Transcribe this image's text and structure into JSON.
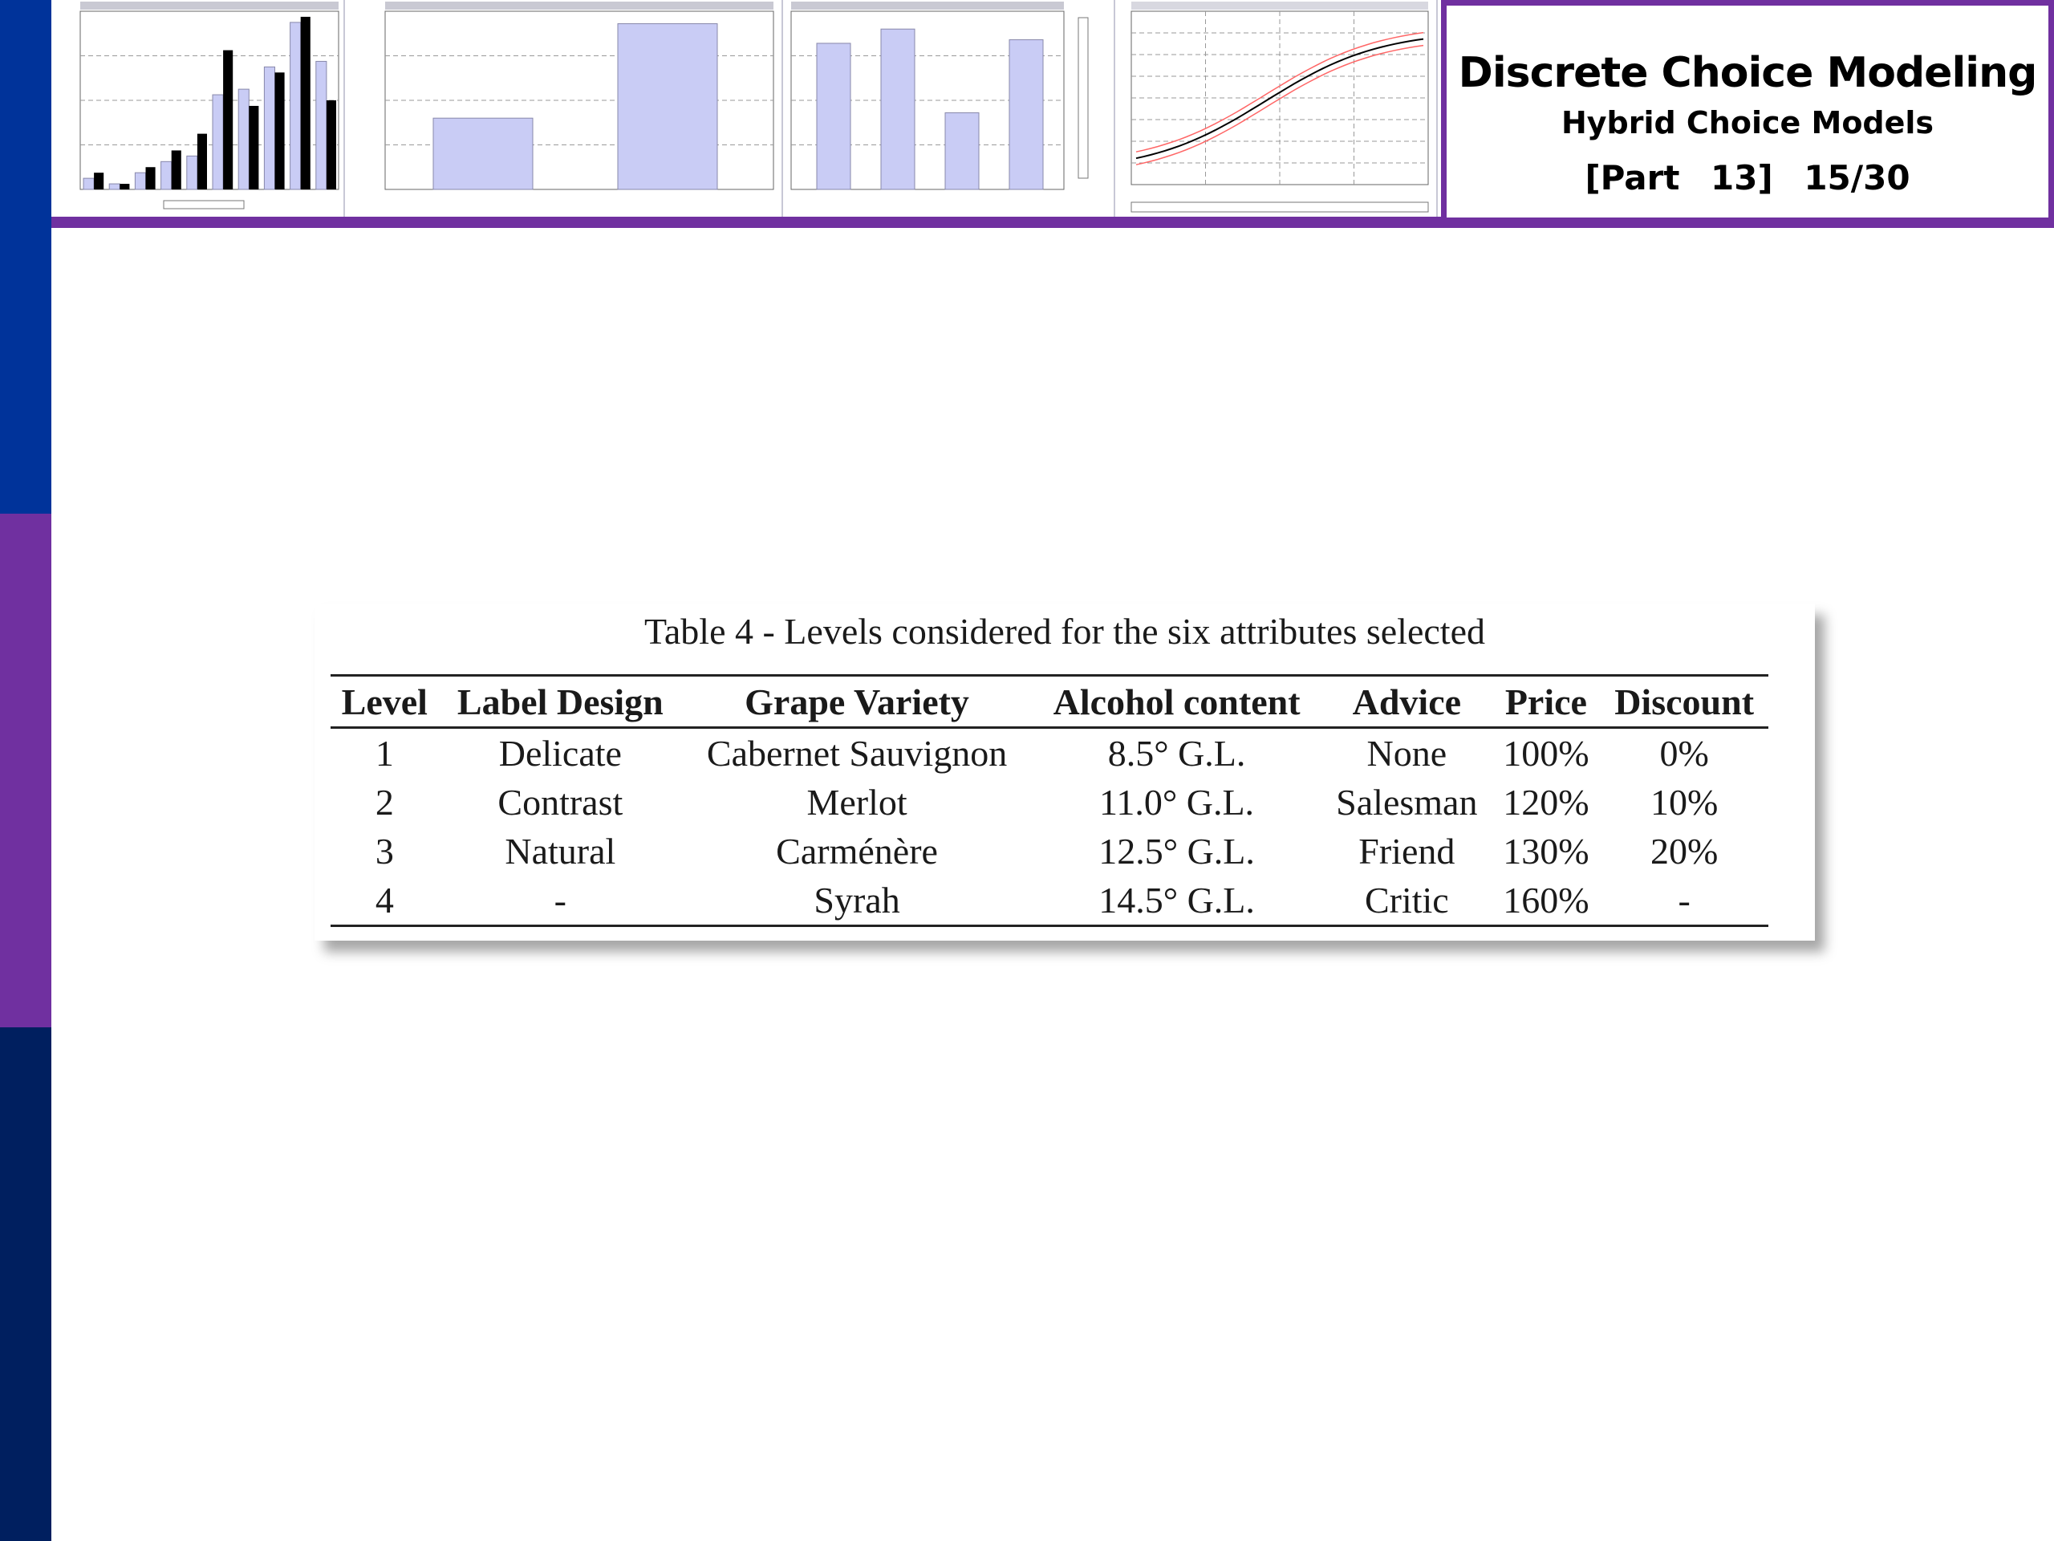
{
  "header": {
    "title": "Discrete Choice Modeling",
    "subtitle": "Hybrid Choice Models",
    "part": "[Part 13]",
    "page": "15/30"
  },
  "colors": {
    "side_blue": "#00339a",
    "side_purple": "#7030a0",
    "side_navy": "#001f5f",
    "accent_purple": "#7030a0",
    "bar_light": "#c9ccf5",
    "bar_dark": "#000000",
    "curve_red": "#ff6666"
  },
  "thumbnails": {
    "histogram": {
      "light_values": [
        2,
        1,
        3,
        5,
        6,
        17,
        18,
        22,
        30,
        23
      ],
      "dark_values": [
        3,
        1,
        4,
        7,
        10,
        25,
        15,
        21,
        31,
        16
      ]
    },
    "bar2_values": [
      40,
      93
    ],
    "bar3_values": [
      82,
      90,
      43,
      84
    ]
  },
  "table": {
    "caption": "Table 4 - Levels considered for the six attributes selected",
    "columns": [
      "Level",
      "Label Design",
      "Grape Variety",
      "Alcohol content",
      "Advice",
      "Price",
      "Discount"
    ],
    "rows": [
      [
        "1",
        "Delicate",
        "Cabernet Sauvignon",
        "8.5° G.L.",
        "None",
        "100%",
        "0%"
      ],
      [
        "2",
        "Contrast",
        "Merlot",
        "11.0° G.L.",
        "Salesman",
        "120%",
        "10%"
      ],
      [
        "3",
        "Natural",
        "Carménère",
        "12.5° G.L.",
        "Friend",
        "130%",
        "20%"
      ],
      [
        "4",
        "-",
        "Syrah",
        "14.5° G.L.",
        "Critic",
        "160%",
        "-"
      ]
    ]
  }
}
